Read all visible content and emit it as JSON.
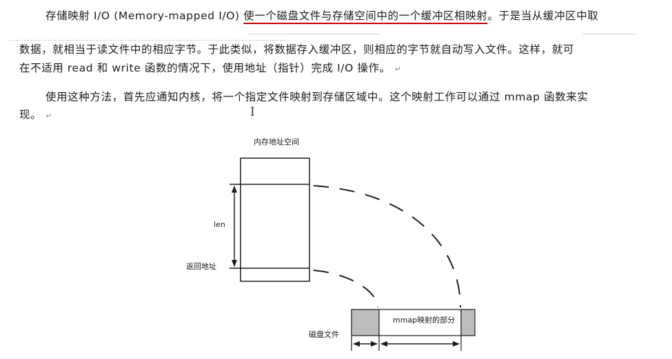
{
  "paragraph1": {
    "line1_lead": "存储映射 I/O (Memory-mapped I/O) ",
    "line1_underlined": "使一个磁盘文件与存储空间中的一个缓冲区相映射",
    "line1_tail": "。于是当从缓冲区中取",
    "line2": "数据，就相当于读文件中的相应字节。于此类似，将数据存入缓冲区，则相应的字节就自动写入文件。这样，就可",
    "line3": "在不适用 read 和 write 函数的情况下，使用地址（指针）完成 I/O 操作。"
  },
  "paragraph2": {
    "line1": "使用这种方法，首先应通知内核，将一个指定文件映射到存储区域中。这个映射工作可以通过 mmap 函数来实",
    "line2": "现。"
  },
  "pilcrow_glyph": "↵",
  "text_cursor_glyph": "I",
  "diagram": {
    "memory_label": "内存地址空间",
    "len_label": "len",
    "return_address_label": "返回地址",
    "mmap_region_label": "mmap映射的部分",
    "disk_file_label": "磁盘文件"
  },
  "colors": {
    "underline": "#c40000",
    "shaded_block": "#bdbdbd",
    "text": "#1a1a1a"
  }
}
